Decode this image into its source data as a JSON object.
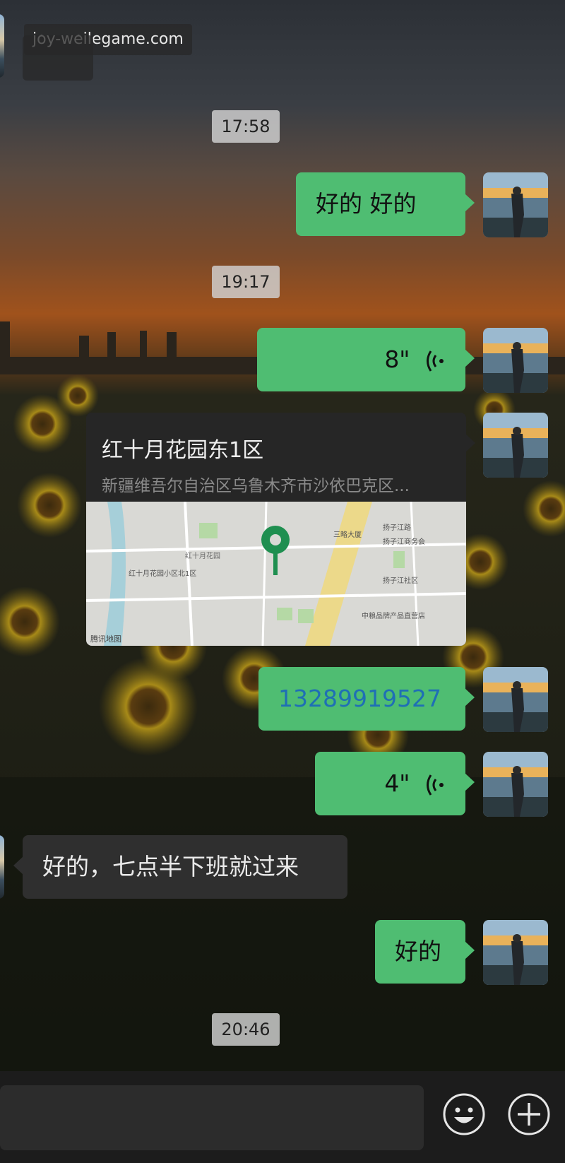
{
  "watermark": "joy-weilegame.com",
  "timestamps": [
    "17:58",
    "19:17",
    "20:46"
  ],
  "messages": {
    "m1": "好的  好的",
    "voice1": "8\"",
    "location_title": "红十月花园东1区",
    "location_address": "新疆维吾尔自治区乌鲁木齐市沙依巴克区...",
    "phone": "13289919527",
    "voice2": "4\"",
    "incoming": "好的，七点半下班就过来",
    "m_last": "好的"
  },
  "map_labels": {
    "provider": "腾讯地图",
    "community": "红十月花园",
    "area": "红十月花园小区北1区",
    "street1": "三略大厦",
    "street2": "扬子江路",
    "street3": "扬子江商务会",
    "street4": "扬子江社区",
    "street5": "中粮品牌产品直营店"
  },
  "icons": {
    "voice": "voice-wave-icon",
    "emoji": "emoji-icon",
    "plus": "plus-icon",
    "pin": "map-pin-icon"
  },
  "colors": {
    "bubble_out": "#4fbd72",
    "bubble_in": "#2f2f2f",
    "link": "#1f6fb5"
  }
}
